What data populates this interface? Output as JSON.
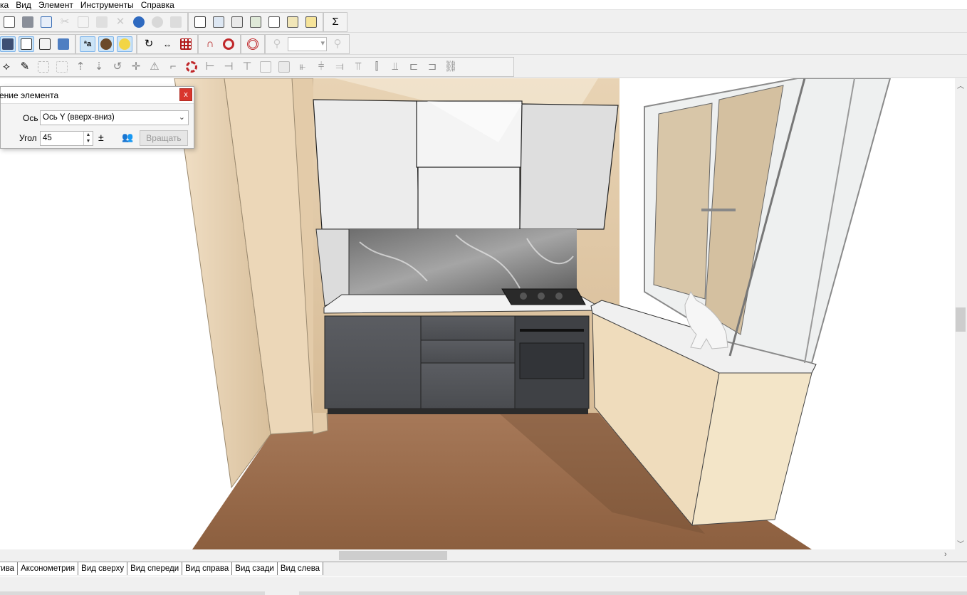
{
  "menu": [
    "ка",
    "Вид",
    "Элемент",
    "Инструменты",
    "Справка"
  ],
  "toolbar_icons": {
    "row1": [
      "new-doc-icon",
      "print-icon",
      "print-preview-icon",
      "cut-icon",
      "copy-icon",
      "paste-icon",
      "delete-icon",
      "undo-icon",
      "redo-icon",
      "properties-icon",
      "checklist-icon",
      "report-icon",
      "report-detail-icon",
      "dimensions-icon",
      "export-icon",
      "price-icon",
      "sum-icon"
    ],
    "sum_glyph": "Σ",
    "row2": [
      "solid-view-icon",
      "wireframe-view-icon",
      "box-view-icon",
      "shaded-cube-icon",
      "text-labels-icon",
      "materials-icon",
      "light-icon",
      "rotate-icon",
      "measure-icon",
      "grid-icon",
      "magnet-icon",
      "snap-icon",
      "target-icon",
      "zoom-out-icon",
      "zoom-in-icon"
    ],
    "row3": [
      "select-icon",
      "pen-icon",
      "select-area-icon",
      "select-group-icon",
      "move-up-icon",
      "move-down-icon",
      "rotate-element-icon",
      "move-cross-icon",
      "warning-icon",
      "wall-icon",
      "lifebuoy-icon",
      "align-left-icon",
      "align-center-icon",
      "align-top-icon",
      "copy-element-icon",
      "paste-element-icon",
      "distribute-left-icon",
      "distribute-center-icon",
      "distribute-right-icon",
      "distribute-top-icon",
      "distribute-middle-icon",
      "distribute-bottom-icon",
      "dimension-icon",
      "dimension-alt-icon",
      "chain-icon"
    ]
  },
  "dialog": {
    "title": "ение элемента",
    "close_label": "x",
    "axis_label": "Ось",
    "axis_value": "Ось Y (вверх-вниз)",
    "angle_label": "Угол",
    "angle_value": "45",
    "rotate_button": "Вращать"
  },
  "tabs": [
    "тива",
    "Аксонометрия",
    "Вид сверху",
    "Вид спереди",
    "Вид справа",
    "Вид сзади",
    "Вид слева"
  ]
}
